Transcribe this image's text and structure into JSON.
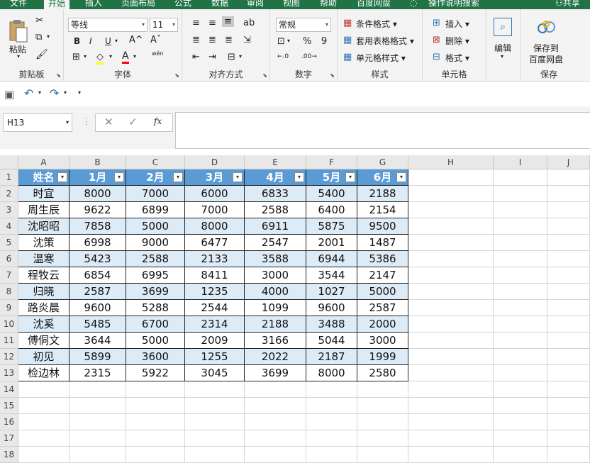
{
  "tabs": [
    "文件",
    "开始",
    "插入",
    "页面布局",
    "公式",
    "数据",
    "审阅",
    "视图",
    "帮助",
    "百度网盘",
    "操作说明搜索",
    "共享"
  ],
  "ribbon": {
    "clipboard": {
      "paste": "粘贴",
      "label": "剪贴板"
    },
    "font": {
      "name": "等线",
      "size": "11",
      "bold": "B",
      "italic": "I",
      "underline": "U",
      "font_color": "A",
      "pinyin": "wén",
      "label": "字体"
    },
    "align": {
      "label": "对齐方式"
    },
    "number": {
      "format": "常规",
      "percent": "%",
      "comma": "9",
      "label": "数字"
    },
    "styles": {
      "conditional": "条件格式",
      "table": "套用表格格式",
      "cell": "单元格样式",
      "label": "样式"
    },
    "cells": {
      "insert": "插入",
      "delete": "删除",
      "format": "格式",
      "label": "单元格"
    },
    "edit": {
      "label": "编辑"
    },
    "save": {
      "line1": "保存到",
      "line2": "百度网盘",
      "label": "保存"
    }
  },
  "namebox": "H13",
  "fx": "fx",
  "columns": [
    "A",
    "B",
    "C",
    "D",
    "E",
    "F",
    "G",
    "H",
    "I",
    "J"
  ],
  "rows": [
    "1",
    "2",
    "3",
    "4",
    "5",
    "6",
    "7",
    "8",
    "9",
    "10",
    "11",
    "12",
    "13",
    "14",
    "15",
    "16",
    "17",
    "18"
  ],
  "table": {
    "headers": [
      "姓名",
      "1月",
      "2月",
      "3月",
      "4月",
      "5月",
      "6月"
    ],
    "data": [
      [
        "时宜",
        "8000",
        "7000",
        "6000",
        "6833",
        "5400",
        "2188"
      ],
      [
        "周生辰",
        "9622",
        "6899",
        "7000",
        "2588",
        "6400",
        "2154"
      ],
      [
        "沈昭昭",
        "7858",
        "5000",
        "8000",
        "6911",
        "5875",
        "9500"
      ],
      [
        "沈策",
        "6998",
        "9000",
        "6477",
        "2547",
        "2001",
        "1487"
      ],
      [
        "温寒",
        "5423",
        "2588",
        "2133",
        "3588",
        "6944",
        "5386"
      ],
      [
        "程牧云",
        "6854",
        "6995",
        "8411",
        "3000",
        "3544",
        "2147"
      ],
      [
        "归晓",
        "2587",
        "3699",
        "1235",
        "4000",
        "1027",
        "5000"
      ],
      [
        "路炎晨",
        "9600",
        "5288",
        "2544",
        "1099",
        "9600",
        "2587"
      ],
      [
        "沈奚",
        "5485",
        "6700",
        "2314",
        "2188",
        "3488",
        "2000"
      ],
      [
        "傅侗文",
        "3644",
        "5000",
        "2009",
        "3166",
        "5044",
        "3000"
      ],
      [
        "初见",
        "5899",
        "3600",
        "1255",
        "2022",
        "2187",
        "1999"
      ],
      [
        "检边林",
        "2315",
        "5922",
        "3045",
        "3699",
        "8000",
        "2580"
      ]
    ]
  }
}
